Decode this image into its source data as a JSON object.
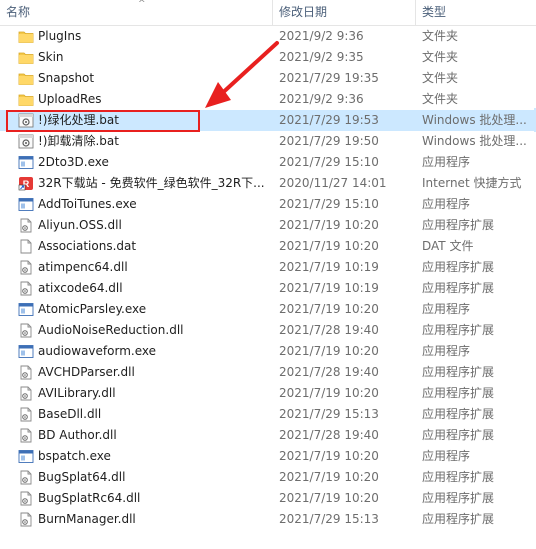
{
  "header": {
    "name": "名称",
    "date": "修改日期",
    "type": "类型",
    "sort_glyph": "^"
  },
  "files": [
    {
      "name": "PlugIns",
      "date": "2021/9/2 9:36",
      "type": "文件夹",
      "icon": "folder-icon"
    },
    {
      "name": "Skin",
      "date": "2021/9/2 9:35",
      "type": "文件夹",
      "icon": "folder-icon"
    },
    {
      "name": "Snapshot",
      "date": "2021/7/29 19:35",
      "type": "文件夹",
      "icon": "folder-icon"
    },
    {
      "name": "UploadRes",
      "date": "2021/9/2 9:36",
      "type": "文件夹",
      "icon": "folder-icon"
    },
    {
      "name": "!)绿化处理.bat",
      "date": "2021/7/29 19:53",
      "type": "Windows 批处理...",
      "icon": "batch-file-icon",
      "selected": true
    },
    {
      "name": "!)卸载清除.bat",
      "date": "2021/7/29 19:50",
      "type": "Windows 批处理...",
      "icon": "batch-file-icon"
    },
    {
      "name": "2Dto3D.exe",
      "date": "2021/7/29 15:10",
      "type": "应用程序",
      "icon": "exe-icon"
    },
    {
      "name": "32R下载站 - 免费软件_绿色软件_32R下...",
      "date": "2020/11/27 14:01",
      "type": "Internet 快捷方式",
      "icon": "shortcut-icon"
    },
    {
      "name": "AddToiTunes.exe",
      "date": "2021/7/29 15:10",
      "type": "应用程序",
      "icon": "exe-icon"
    },
    {
      "name": "Aliyun.OSS.dll",
      "date": "2021/7/19 10:20",
      "type": "应用程序扩展",
      "icon": "dll-icon"
    },
    {
      "name": "Associations.dat",
      "date": "2021/7/19 10:20",
      "type": "DAT 文件",
      "icon": "dat-icon"
    },
    {
      "name": "atimpenc64.dll",
      "date": "2021/7/19 10:19",
      "type": "应用程序扩展",
      "icon": "dll-icon"
    },
    {
      "name": "atixcode64.dll",
      "date": "2021/7/19 10:19",
      "type": "应用程序扩展",
      "icon": "dll-icon"
    },
    {
      "name": "AtomicParsley.exe",
      "date": "2021/7/19 10:20",
      "type": "应用程序",
      "icon": "exe-icon"
    },
    {
      "name": "AudioNoiseReduction.dll",
      "date": "2021/7/28 19:40",
      "type": "应用程序扩展",
      "icon": "dll-icon"
    },
    {
      "name": "audiowaveform.exe",
      "date": "2021/7/19 10:20",
      "type": "应用程序",
      "icon": "exe-icon"
    },
    {
      "name": "AVCHDParser.dll",
      "date": "2021/7/28 19:40",
      "type": "应用程序扩展",
      "icon": "dll-icon"
    },
    {
      "name": "AVILibrary.dll",
      "date": "2021/7/19 10:20",
      "type": "应用程序扩展",
      "icon": "dll-icon"
    },
    {
      "name": "BaseDll.dll",
      "date": "2021/7/29 15:13",
      "type": "应用程序扩展",
      "icon": "dll-icon"
    },
    {
      "name": "BD Author.dll",
      "date": "2021/7/28 19:40",
      "type": "应用程序扩展",
      "icon": "dll-icon"
    },
    {
      "name": "bspatch.exe",
      "date": "2021/7/19 10:20",
      "type": "应用程序",
      "icon": "exe-icon"
    },
    {
      "name": "BugSplat64.dll",
      "date": "2021/7/19 10:20",
      "type": "应用程序扩展",
      "icon": "dll-icon"
    },
    {
      "name": "BugSplatRc64.dll",
      "date": "2021/7/19 10:20",
      "type": "应用程序扩展",
      "icon": "dll-icon"
    },
    {
      "name": "BurnManager.dll",
      "date": "2021/7/29 15:13",
      "type": "应用程序扩展",
      "icon": "dll-icon"
    }
  ],
  "annotation": {
    "color": "#e8201f"
  }
}
